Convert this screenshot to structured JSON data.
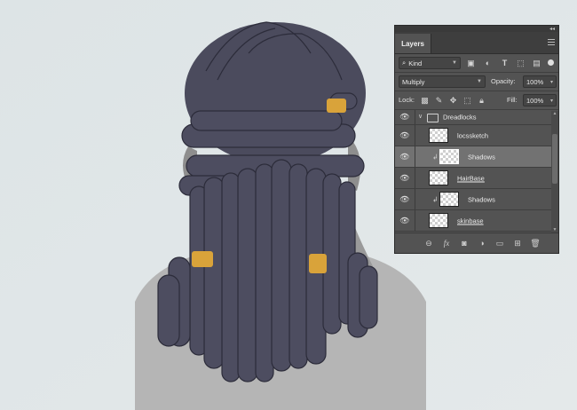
{
  "panel": {
    "collapse_glyph": "◂◂",
    "close_glyph": "×",
    "tab_label": "Layers",
    "menu_icon": "menu-icon"
  },
  "filter": {
    "search_icon": "⌕",
    "kind_label": "Kind",
    "icons": [
      "image-filter-icon",
      "adjustment-filter-icon",
      "type-filter-icon",
      "shape-filter-icon",
      "smart-object-filter-icon"
    ]
  },
  "blend": {
    "mode": "Multiply",
    "opacity_label": "Opacity:",
    "opacity_value": "100%"
  },
  "lock": {
    "label": "Lock:",
    "fill_label": "Fill:",
    "fill_value": "100%"
  },
  "layers": [
    {
      "name": "Dreadlocks",
      "type": "folder",
      "expanded": true
    },
    {
      "name": "locssketch",
      "type": "layer",
      "underline": false,
      "clipped": false
    },
    {
      "name": "Shadows",
      "type": "layer",
      "underline": false,
      "clipped": true,
      "selected": true
    },
    {
      "name": "HairBase",
      "type": "layer",
      "underline": true,
      "clipped": false
    },
    {
      "name": "Shadows",
      "type": "layer",
      "underline": false,
      "clipped": true
    },
    {
      "name": "skinbase",
      "type": "layer",
      "underline": true,
      "clipped": false
    }
  ],
  "bottom_icons": [
    "link-layers-icon",
    "fx-icon",
    "add-mask-icon",
    "adjustment-layer-icon",
    "new-group-icon",
    "new-layer-icon",
    "trash-icon"
  ],
  "colors": {
    "canvas_bg": "#dfe5e6",
    "hair": "#4a4a5c",
    "hair_tie": "#d9a33a",
    "skin": "#9b9b9b",
    "panel_bg": "#535353",
    "selected_row": "#727272"
  }
}
